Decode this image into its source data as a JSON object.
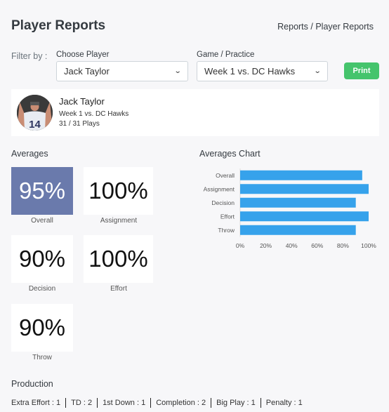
{
  "header": {
    "title": "Player Reports",
    "breadcrumb": "Reports / Player Reports"
  },
  "filters": {
    "label": "Filter by :",
    "player": {
      "label": "Choose Player",
      "value": "Jack Taylor"
    },
    "game": {
      "label": "Game / Practice",
      "value": "Week 1 vs. DC Hawks"
    },
    "print_label": "Print"
  },
  "player": {
    "name": "Jack Taylor",
    "game": "Week 1 vs. DC Hawks",
    "plays": "31 / 31 Plays",
    "jersey": "14"
  },
  "averages": {
    "title": "Averages",
    "tiles": [
      {
        "label": "Overall",
        "value": "95%"
      },
      {
        "label": "Assignment",
        "value": "100%"
      },
      {
        "label": "Decision",
        "value": "90%"
      },
      {
        "label": "Effort",
        "value": "100%"
      },
      {
        "label": "Throw",
        "value": "90%"
      }
    ]
  },
  "chart_title": "Averages Chart",
  "chart_data": {
    "type": "bar",
    "orientation": "horizontal",
    "categories": [
      "Overall",
      "Assignment",
      "Decision",
      "Effort",
      "Throw"
    ],
    "values": [
      95,
      100,
      90,
      100,
      90
    ],
    "xlim": [
      0,
      100
    ],
    "xticks": [
      "0%",
      "20%",
      "40%",
      "60%",
      "80%",
      "100%"
    ],
    "color": "#36a2eb",
    "title": "Averages Chart",
    "xlabel": "",
    "ylabel": ""
  },
  "production": {
    "title": "Production",
    "items": [
      "Extra Effort : 1",
      "TD : 2",
      "1st Down : 1",
      "Completion : 2",
      "Big Play : 1",
      "Penalty : 1"
    ]
  }
}
